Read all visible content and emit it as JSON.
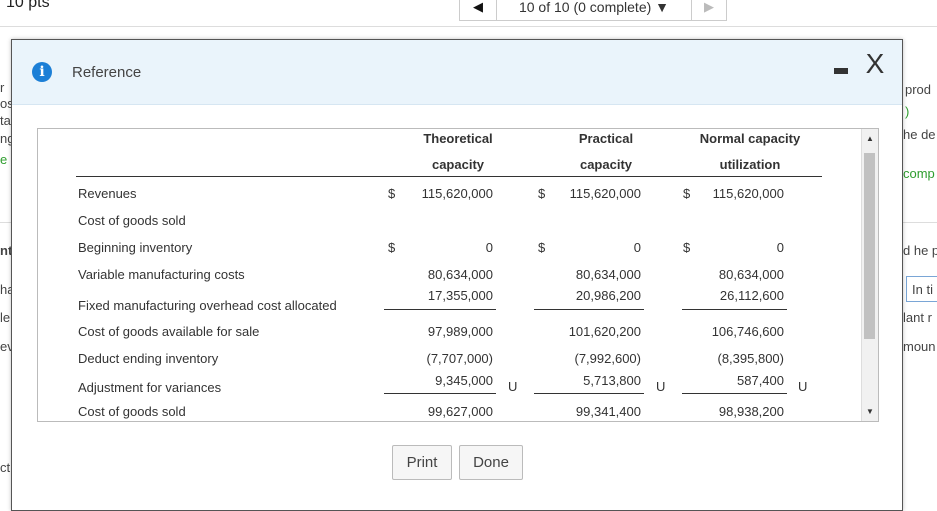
{
  "background": {
    "points": "10 pts",
    "nav_status": "10 of 10 (0 complete)",
    "nav_prev": "◀",
    "nav_next": "▶",
    "right_fragments": [
      "prod",
      ")",
      "he de",
      "comp",
      "d he p",
      "In ti",
      "lant r",
      "moun"
    ],
    "left_fragments": [
      "r",
      "os",
      "ta",
      "ng",
      "e",
      "nt",
      "ha",
      "le",
      "ev",
      "ct"
    ]
  },
  "dialog": {
    "title": "Reference",
    "info_icon": "i",
    "minimize_label": "▬",
    "close_label": "X",
    "table": {
      "headers": [
        {
          "line1": "Theoretical",
          "line2": "capacity"
        },
        {
          "line1": "Practical",
          "line2": "capacity"
        },
        {
          "line1": "Normal capacity",
          "line2": "utilization"
        }
      ],
      "rows": [
        {
          "label": "Revenues",
          "dollar": "$",
          "values": [
            "115,620,000",
            "115,620,000",
            "115,620,000"
          ]
        },
        {
          "label": "Cost of goods sold",
          "dollar": "",
          "values": [
            "",
            "",
            ""
          ]
        },
        {
          "label": "Beginning inventory",
          "dollar": "$",
          "values": [
            "0",
            "0",
            "0"
          ]
        },
        {
          "label": "Variable manufacturing costs",
          "dollar": "",
          "values": [
            "80,634,000",
            "80,634,000",
            "80,634,000"
          ]
        },
        {
          "label": "Fixed manufacturing overhead cost allocated",
          "dollar": "",
          "values": [
            "17,355,000",
            "20,986,200",
            "26,112,600"
          ]
        },
        {
          "label": "Cost of goods available for sale",
          "dollar": "",
          "values": [
            "97,989,000",
            "101,620,200",
            "106,746,600"
          ]
        },
        {
          "label": "Deduct ending inventory",
          "dollar": "",
          "values": [
            "(7,707,000)",
            "(7,992,600)",
            "(8,395,800)"
          ]
        },
        {
          "label": "Adjustment for variances",
          "dollar": "",
          "values": [
            "9,345,000",
            "5,713,800",
            "587,400"
          ],
          "flag": "U"
        },
        {
          "label": "Cost of goods sold",
          "dollar": "",
          "values": [
            "99,627,000",
            "99,341,400",
            "98,938,200"
          ]
        }
      ]
    },
    "buttons": {
      "print": "Print",
      "done": "Done"
    }
  }
}
